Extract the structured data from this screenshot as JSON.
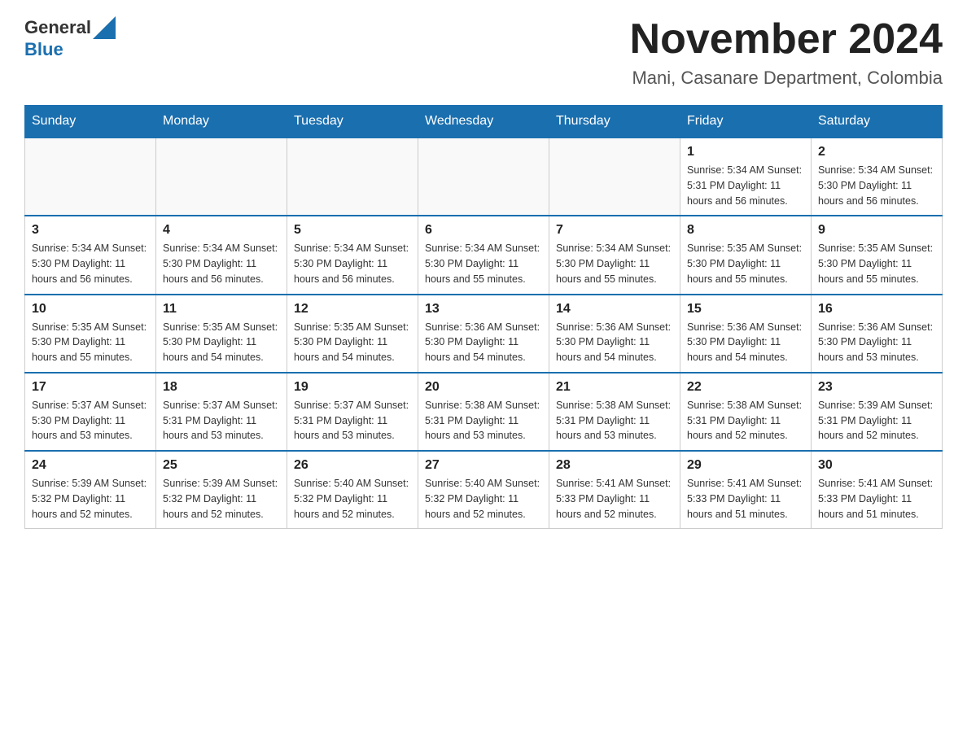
{
  "header": {
    "logo_general": "General",
    "logo_blue": "Blue",
    "title": "November 2024",
    "subtitle": "Mani, Casanare Department, Colombia"
  },
  "calendar": {
    "days_of_week": [
      "Sunday",
      "Monday",
      "Tuesday",
      "Wednesday",
      "Thursday",
      "Friday",
      "Saturday"
    ],
    "weeks": [
      {
        "days": [
          {
            "number": "",
            "info": ""
          },
          {
            "number": "",
            "info": ""
          },
          {
            "number": "",
            "info": ""
          },
          {
            "number": "",
            "info": ""
          },
          {
            "number": "",
            "info": ""
          },
          {
            "number": "1",
            "info": "Sunrise: 5:34 AM\nSunset: 5:31 PM\nDaylight: 11 hours\nand 56 minutes."
          },
          {
            "number": "2",
            "info": "Sunrise: 5:34 AM\nSunset: 5:30 PM\nDaylight: 11 hours\nand 56 minutes."
          }
        ]
      },
      {
        "days": [
          {
            "number": "3",
            "info": "Sunrise: 5:34 AM\nSunset: 5:30 PM\nDaylight: 11 hours\nand 56 minutes."
          },
          {
            "number": "4",
            "info": "Sunrise: 5:34 AM\nSunset: 5:30 PM\nDaylight: 11 hours\nand 56 minutes."
          },
          {
            "number": "5",
            "info": "Sunrise: 5:34 AM\nSunset: 5:30 PM\nDaylight: 11 hours\nand 56 minutes."
          },
          {
            "number": "6",
            "info": "Sunrise: 5:34 AM\nSunset: 5:30 PM\nDaylight: 11 hours\nand 55 minutes."
          },
          {
            "number": "7",
            "info": "Sunrise: 5:34 AM\nSunset: 5:30 PM\nDaylight: 11 hours\nand 55 minutes."
          },
          {
            "number": "8",
            "info": "Sunrise: 5:35 AM\nSunset: 5:30 PM\nDaylight: 11 hours\nand 55 minutes."
          },
          {
            "number": "9",
            "info": "Sunrise: 5:35 AM\nSunset: 5:30 PM\nDaylight: 11 hours\nand 55 minutes."
          }
        ]
      },
      {
        "days": [
          {
            "number": "10",
            "info": "Sunrise: 5:35 AM\nSunset: 5:30 PM\nDaylight: 11 hours\nand 55 minutes."
          },
          {
            "number": "11",
            "info": "Sunrise: 5:35 AM\nSunset: 5:30 PM\nDaylight: 11 hours\nand 54 minutes."
          },
          {
            "number": "12",
            "info": "Sunrise: 5:35 AM\nSunset: 5:30 PM\nDaylight: 11 hours\nand 54 minutes."
          },
          {
            "number": "13",
            "info": "Sunrise: 5:36 AM\nSunset: 5:30 PM\nDaylight: 11 hours\nand 54 minutes."
          },
          {
            "number": "14",
            "info": "Sunrise: 5:36 AM\nSunset: 5:30 PM\nDaylight: 11 hours\nand 54 minutes."
          },
          {
            "number": "15",
            "info": "Sunrise: 5:36 AM\nSunset: 5:30 PM\nDaylight: 11 hours\nand 54 minutes."
          },
          {
            "number": "16",
            "info": "Sunrise: 5:36 AM\nSunset: 5:30 PM\nDaylight: 11 hours\nand 53 minutes."
          }
        ]
      },
      {
        "days": [
          {
            "number": "17",
            "info": "Sunrise: 5:37 AM\nSunset: 5:30 PM\nDaylight: 11 hours\nand 53 minutes."
          },
          {
            "number": "18",
            "info": "Sunrise: 5:37 AM\nSunset: 5:31 PM\nDaylight: 11 hours\nand 53 minutes."
          },
          {
            "number": "19",
            "info": "Sunrise: 5:37 AM\nSunset: 5:31 PM\nDaylight: 11 hours\nand 53 minutes."
          },
          {
            "number": "20",
            "info": "Sunrise: 5:38 AM\nSunset: 5:31 PM\nDaylight: 11 hours\nand 53 minutes."
          },
          {
            "number": "21",
            "info": "Sunrise: 5:38 AM\nSunset: 5:31 PM\nDaylight: 11 hours\nand 53 minutes."
          },
          {
            "number": "22",
            "info": "Sunrise: 5:38 AM\nSunset: 5:31 PM\nDaylight: 11 hours\nand 52 minutes."
          },
          {
            "number": "23",
            "info": "Sunrise: 5:39 AM\nSunset: 5:31 PM\nDaylight: 11 hours\nand 52 minutes."
          }
        ]
      },
      {
        "days": [
          {
            "number": "24",
            "info": "Sunrise: 5:39 AM\nSunset: 5:32 PM\nDaylight: 11 hours\nand 52 minutes."
          },
          {
            "number": "25",
            "info": "Sunrise: 5:39 AM\nSunset: 5:32 PM\nDaylight: 11 hours\nand 52 minutes."
          },
          {
            "number": "26",
            "info": "Sunrise: 5:40 AM\nSunset: 5:32 PM\nDaylight: 11 hours\nand 52 minutes."
          },
          {
            "number": "27",
            "info": "Sunrise: 5:40 AM\nSunset: 5:32 PM\nDaylight: 11 hours\nand 52 minutes."
          },
          {
            "number": "28",
            "info": "Sunrise: 5:41 AM\nSunset: 5:33 PM\nDaylight: 11 hours\nand 52 minutes."
          },
          {
            "number": "29",
            "info": "Sunrise: 5:41 AM\nSunset: 5:33 PM\nDaylight: 11 hours\nand 51 minutes."
          },
          {
            "number": "30",
            "info": "Sunrise: 5:41 AM\nSunset: 5:33 PM\nDaylight: 11 hours\nand 51 minutes."
          }
        ]
      }
    ]
  }
}
